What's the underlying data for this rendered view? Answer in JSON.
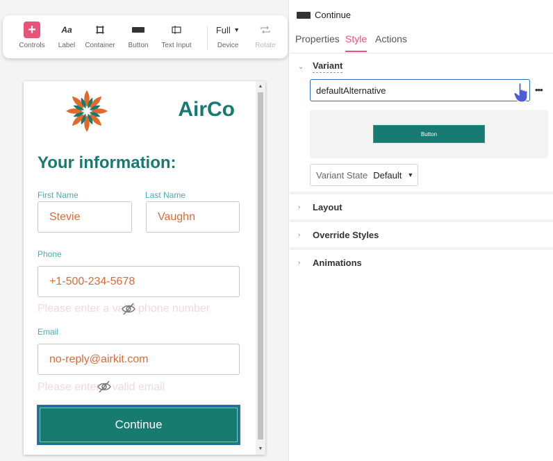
{
  "toolbar": {
    "tools": [
      {
        "label": "Controls",
        "icon": "plus-icon"
      },
      {
        "label": "Label",
        "icon": "label-icon",
        "glyph": "Aa"
      },
      {
        "label": "Container",
        "icon": "container-icon"
      },
      {
        "label": "Button",
        "icon": "button-icon"
      },
      {
        "label": "Text Input",
        "icon": "text-input-icon"
      }
    ],
    "device": {
      "label": "Device",
      "value": "Full"
    },
    "rotate": {
      "label": "Rotate",
      "icon": "rotate-icon"
    }
  },
  "preview": {
    "brand": "AirCo",
    "title": "Your information:",
    "first_name": {
      "label": "First Name",
      "value": "Stevie"
    },
    "last_name": {
      "label": "Last Name",
      "value": "Vaughn"
    },
    "phone": {
      "label": "Phone",
      "value": "+1-500-234-5678",
      "hint": "Please enter a valid phone number"
    },
    "email": {
      "label": "Email",
      "value": "no-reply@airkit.com",
      "hint": "Please enter a valid email"
    },
    "cta": "Continue"
  },
  "panel": {
    "title": "Continue",
    "tabs": [
      "Properties",
      "Style",
      "Actions"
    ],
    "active_tab": "Style",
    "variant": {
      "section": "Variant",
      "value": "defaultAlternative",
      "preview_button": "Button",
      "state_label": "Variant State",
      "state_value": "Default"
    },
    "sections": [
      "Layout",
      "Override Styles",
      "Animations"
    ]
  },
  "colors": {
    "accent": "#e8537a",
    "brand_teal": "#177a72",
    "field_value": "#d96b3b",
    "field_label": "#4aaab1",
    "focus_blue": "#2b6fb8"
  }
}
